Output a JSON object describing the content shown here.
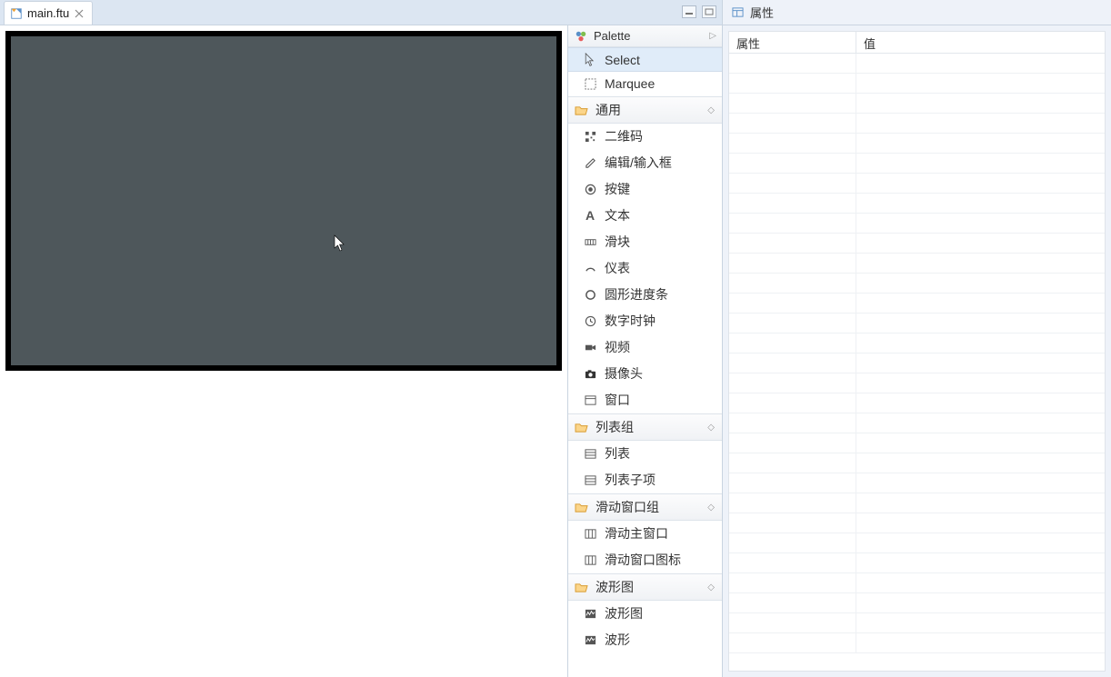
{
  "editor": {
    "tab": {
      "label": "main.ftu"
    }
  },
  "palette": {
    "title": "Palette",
    "tools": [
      {
        "id": "select",
        "label": "Select",
        "icon": "cursor",
        "selected": true
      },
      {
        "id": "marquee",
        "label": "Marquee",
        "icon": "marquee"
      }
    ],
    "categories": [
      {
        "id": "general",
        "label": "通用",
        "items": [
          {
            "id": "qrcode",
            "label": "二维码",
            "icon": "qrcode"
          },
          {
            "id": "edit",
            "label": "编辑/输入框",
            "icon": "pencil"
          },
          {
            "id": "button",
            "label": "按键",
            "icon": "radio"
          },
          {
            "id": "text",
            "label": "文本",
            "icon": "text-a"
          },
          {
            "id": "slider",
            "label": "滑块",
            "icon": "slider"
          },
          {
            "id": "gauge",
            "label": "仪表",
            "icon": "gauge"
          },
          {
            "id": "circleprogress",
            "label": "圆形进度条",
            "icon": "circle"
          },
          {
            "id": "digitalclock",
            "label": "数字时钟",
            "icon": "clock"
          },
          {
            "id": "video",
            "label": "视频",
            "icon": "video"
          },
          {
            "id": "camera",
            "label": "摄像头",
            "icon": "camera"
          },
          {
            "id": "window",
            "label": "窗口",
            "icon": "window"
          }
        ]
      },
      {
        "id": "listgroup",
        "label": "列表组",
        "items": [
          {
            "id": "list",
            "label": "列表",
            "icon": "list"
          },
          {
            "id": "listitem",
            "label": "列表子项",
            "icon": "list"
          }
        ]
      },
      {
        "id": "slidegroup",
        "label": "滑动窗口组",
        "items": [
          {
            "id": "slidemain",
            "label": "滑动主窗口",
            "icon": "grid"
          },
          {
            "id": "slideicon",
            "label": "滑动窗口图标",
            "icon": "grid"
          }
        ]
      },
      {
        "id": "wavegroup",
        "label": "波形图",
        "items": [
          {
            "id": "wavechart",
            "label": "波形图",
            "icon": "wave"
          },
          {
            "id": "wave",
            "label": "波形",
            "icon": "wave"
          }
        ]
      }
    ]
  },
  "properties": {
    "title": "属性",
    "columns": {
      "name": "属性",
      "value": "值"
    }
  }
}
